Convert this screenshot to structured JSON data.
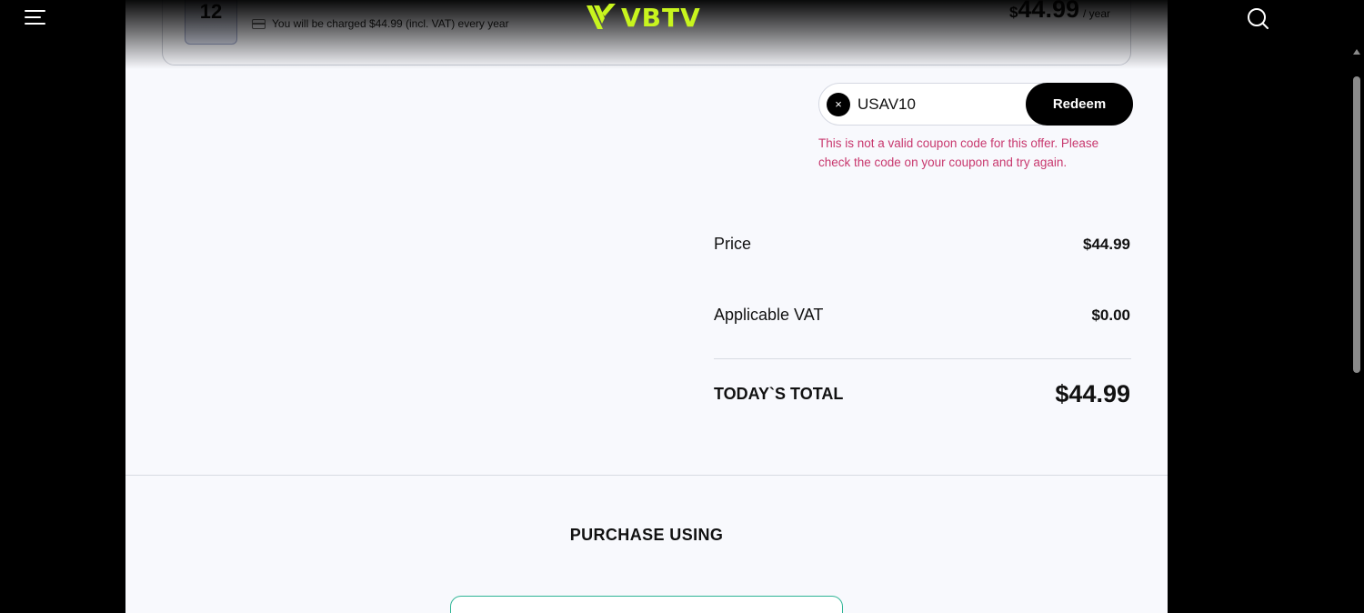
{
  "plan": {
    "months": "12",
    "charge_text": "You will be charged $44.99 (incl. VAT) every year",
    "price_currency": "$",
    "price_amount": "44.99",
    "price_period": "/ year"
  },
  "header": {
    "logo_text": "VBTV",
    "logo_color": "#c8f51e"
  },
  "coupon": {
    "value": "USAV10",
    "clear_label": "×",
    "redeem_label": "Redeem",
    "error": "This is not a valid coupon code for this offer. Please check the code on your coupon and try again.",
    "error_color": "#c8386e"
  },
  "summary": {
    "price_label": "Price",
    "price_value": "$44.99",
    "vat_label": "Applicable VAT",
    "vat_value": "$0.00",
    "total_label": "TODAY`S TOTAL",
    "total_value": "$44.99"
  },
  "purchase": {
    "title": "PURCHASE USING",
    "option_border_color": "#2fb596"
  },
  "icons": {
    "menu": "menu-icon",
    "search": "search-icon",
    "card": "credit-card-icon",
    "close": "close-icon"
  }
}
